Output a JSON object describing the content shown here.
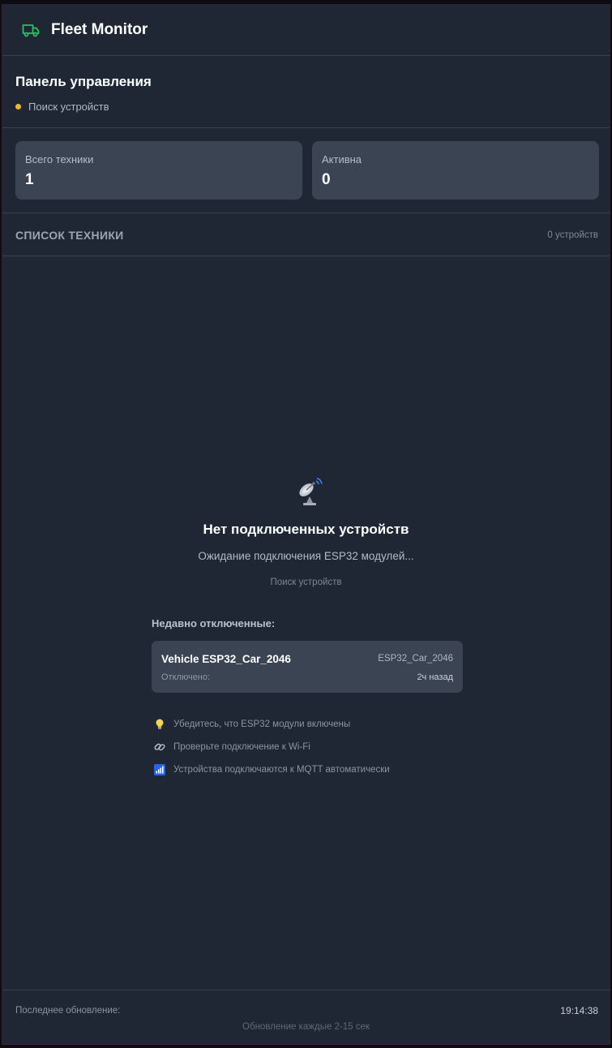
{
  "header": {
    "title": "Fleet Monitor",
    "icon": "truck-icon",
    "icon_color": "#22c55e"
  },
  "panel": {
    "title": "Панель управления",
    "status_text": "Поиск устройств",
    "status_color": "#f5b819"
  },
  "stats": [
    {
      "label": "Всего техники",
      "value": "1"
    },
    {
      "label": "Активна",
      "value": "0"
    }
  ],
  "list": {
    "title": "СПИСОК ТЕХНИКИ",
    "count": "0 устройств"
  },
  "empty": {
    "icon": "satellite-dish-icon",
    "title": "Нет подключенных устройств",
    "subtitle": "Ожидание подключения ESP32 модулей...",
    "search_text": "Поиск устройств"
  },
  "recent": {
    "title": "Недавно отключенные:",
    "items": [
      {
        "name": "Vehicle ESP32_Car_2046",
        "id": "ESP32_Car_2046",
        "status_label": "Отключено:",
        "time_ago": "2ч назад"
      }
    ]
  },
  "tips": [
    {
      "icon": "lightbulb-icon",
      "text": "Убедитесь, что ESP32 модули включены"
    },
    {
      "icon": "link-icon",
      "text": "Проверьте подключение к Wi-Fi"
    },
    {
      "icon": "signal-bars-icon",
      "text": "Устройства подключаются к MQTT автоматически"
    }
  ],
  "footer": {
    "last_update_label": "Последнее обновление:",
    "last_update_time": "19:14:38",
    "interval_text": "Обновление каждые 2-15 сек"
  }
}
